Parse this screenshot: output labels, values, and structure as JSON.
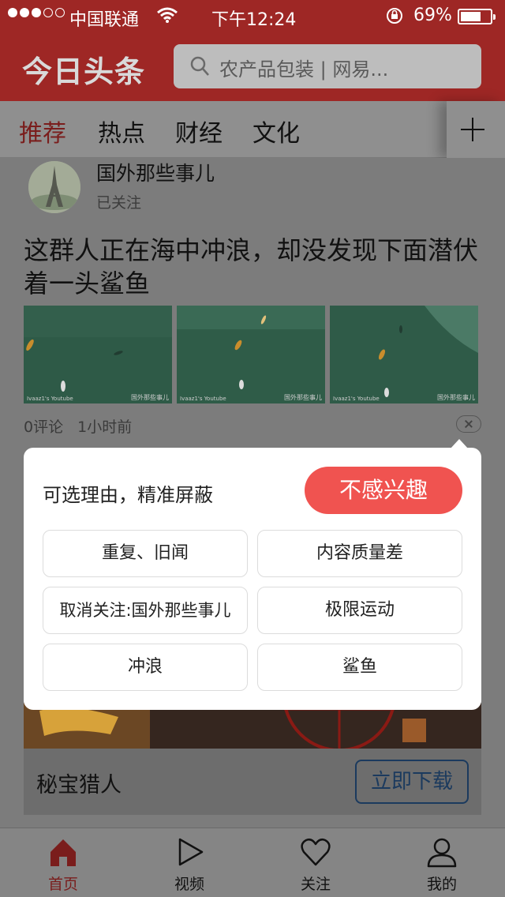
{
  "status_bar": {
    "carrier": "中国联通",
    "time": "下午12:24",
    "battery_percent": "69%",
    "battery_level": 0.69
  },
  "header": {
    "logo": "今日头条",
    "search_placeholder": "农产品包装 | 网易..."
  },
  "tabs": {
    "items": [
      "推荐",
      "热点",
      "财经",
      "文化"
    ],
    "active_index": 0
  },
  "article": {
    "account_name": "国外那些事儿",
    "account_status": "已关注",
    "headline": "这群人正在海中冲浪，却没发现下面潜伏着一头鲨鱼",
    "thumb_watermark": "国外那些事儿",
    "thumb_source": "Ivaaz1's Youtube",
    "comments": "0评论",
    "time_ago": "1小时前"
  },
  "popup": {
    "hint": "可选理由，精准屏蔽",
    "dislike_label": "不感兴趣",
    "reasons": [
      "重复、旧闻",
      "内容质量差",
      "取消关注:国外那些事儿",
      "极限运动",
      "冲浪",
      "鲨鱼"
    ]
  },
  "ad": {
    "title": "秘宝猎人",
    "cta": "立即下载"
  },
  "bottom_nav": {
    "items": [
      {
        "label": "首页",
        "icon": "home-icon"
      },
      {
        "label": "视频",
        "icon": "play-icon"
      },
      {
        "label": "关注",
        "icon": "heart-icon"
      },
      {
        "label": "我的",
        "icon": "user-icon"
      }
    ],
    "active_index": 0
  },
  "colors": {
    "brand_red": "#9e2725",
    "dislike_red": "#f05350",
    "active_tab": "#7a1d1c"
  }
}
